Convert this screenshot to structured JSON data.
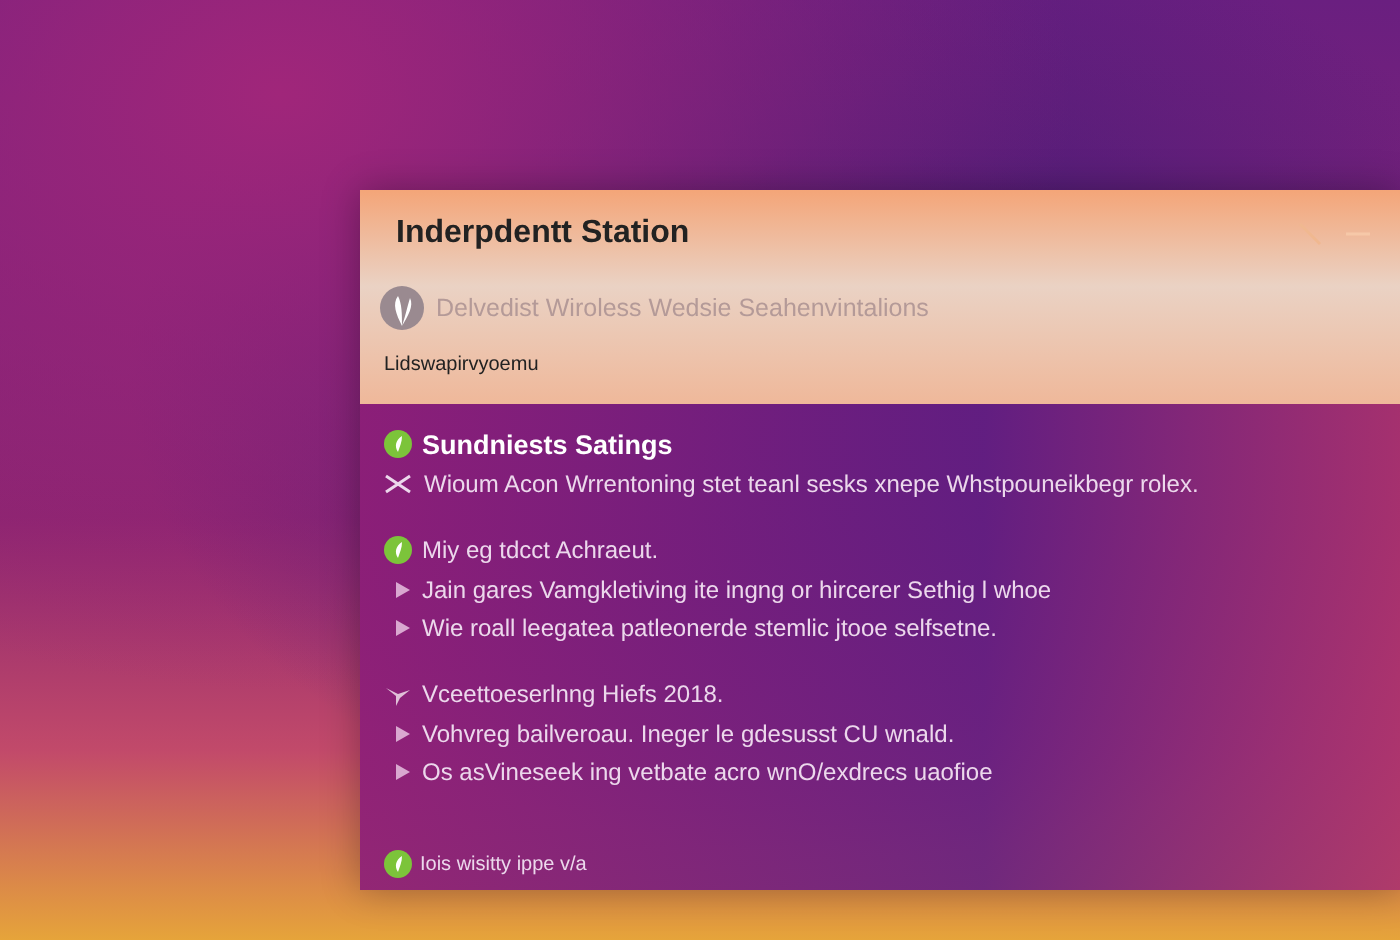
{
  "window": {
    "title": "Inderpdentt Station",
    "subtitle": "Delvedist Wiroless Wedsie Seahenvintalions",
    "link": "Lidswapirvyoemu"
  },
  "sections": [
    {
      "kind": "leaf",
      "heading": "Sundniests Satings",
      "bold": true,
      "lines": [
        {
          "kind": "tool",
          "text": "Wioum Acon Wrrentoning stet teanl sesks xnepe Whstpouneikbegr rolex."
        }
      ]
    },
    {
      "kind": "leaf",
      "heading": "Miy eg tdcct Achraeut.",
      "bold": false,
      "lines": [
        {
          "kind": "bullet",
          "text": "Jain gares Vamgkletiving ite ingng or hircerer Sethig l whoe"
        },
        {
          "kind": "bullet",
          "text": "Wie roall leegatea patleonerde stemlic jtooe selfsetne."
        }
      ]
    },
    {
      "kind": "bird",
      "heading": "Vceettoeserlnng Hiefs 2018.",
      "bold": false,
      "lines": [
        {
          "kind": "bullet",
          "text": "Vohvreg bailveroau. Ineger le gdesusst CU wnald."
        },
        {
          "kind": "bullet",
          "text": "Os asVineseek ing vetbate acro wnO/exdrecs uaofioe"
        }
      ]
    }
  ],
  "footer": {
    "text": "Iois wisitty ippe v/a"
  }
}
